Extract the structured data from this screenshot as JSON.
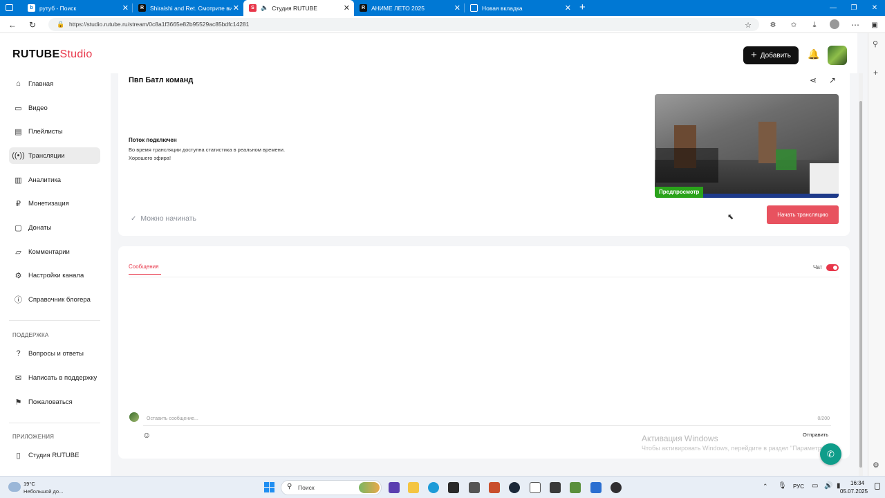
{
  "browser": {
    "tabs": [
      {
        "title": "рутуб - Поиск"
      },
      {
        "title": "Shiraishi and Ret. Смотрите вид"
      },
      {
        "title": "Студия RUTUBE"
      },
      {
        "title": "АНИМЕ ЛЕТО 2025"
      },
      {
        "title": "Новая вкладка"
      }
    ],
    "url": "https://studio.rutube.ru/stream/0c8a1f3665e82b95529ac85bdfc14281"
  },
  "header": {
    "logo_main": "RUTUBE",
    "logo_studio": "Studio",
    "add_label": "Добавить"
  },
  "sidebar": {
    "items": [
      {
        "label": "Главная",
        "icon": "home-icon"
      },
      {
        "label": "Видео",
        "icon": "video-icon"
      },
      {
        "label": "Плейлисты",
        "icon": "playlist-icon"
      },
      {
        "label": "Трансляции",
        "icon": "broadcast-icon"
      },
      {
        "label": "Аналитика",
        "icon": "analytics-icon"
      },
      {
        "label": "Монетизация",
        "icon": "money-icon"
      },
      {
        "label": "Донаты",
        "icon": "donate-icon"
      },
      {
        "label": "Комментарии",
        "icon": "comment-icon"
      },
      {
        "label": "Настройки канала",
        "icon": "gear-icon"
      },
      {
        "label": "Справочник блогера",
        "icon": "info-icon"
      }
    ],
    "support_title": "ПОДДЕРЖКА",
    "support_items": [
      {
        "label": "Вопросы и ответы"
      },
      {
        "label": "Написать в поддержку"
      },
      {
        "label": "Пожаловаться"
      }
    ],
    "apps_title": "ПРИЛОЖЕНИЯ",
    "apps_items": [
      {
        "label": "Студия RUTUBE"
      }
    ]
  },
  "stream": {
    "title": "Пвп Батл команд",
    "status_title": "Поток подключен",
    "status_line1": "Во время трансляции доступна статистика в реальном времени.",
    "status_line2": "Хорошего эфира!",
    "ready_label": "Можно начинать",
    "preview_badge": "Предпросмотр",
    "start_button": "Начать трансляцию"
  },
  "chat": {
    "tab_messages": "Сообщения",
    "toggle_label": "Чат",
    "input_placeholder": "Оставить сообщение...",
    "counter": "0/200",
    "send_label": "Отправить"
  },
  "watermark": {
    "line1": "Активация Windows",
    "line2": "Чтобы активировать Windows, перейдите в раздел \"Параметры\"."
  },
  "taskbar": {
    "weather_temp": "19°C",
    "weather_desc": "Небольшой до...",
    "search_label": "Поиск",
    "lang": "РУС",
    "time": "16:34",
    "date": "05.07.2025"
  },
  "colors": {
    "accent": "#e8374a",
    "browser_blue": "#0078d4"
  }
}
